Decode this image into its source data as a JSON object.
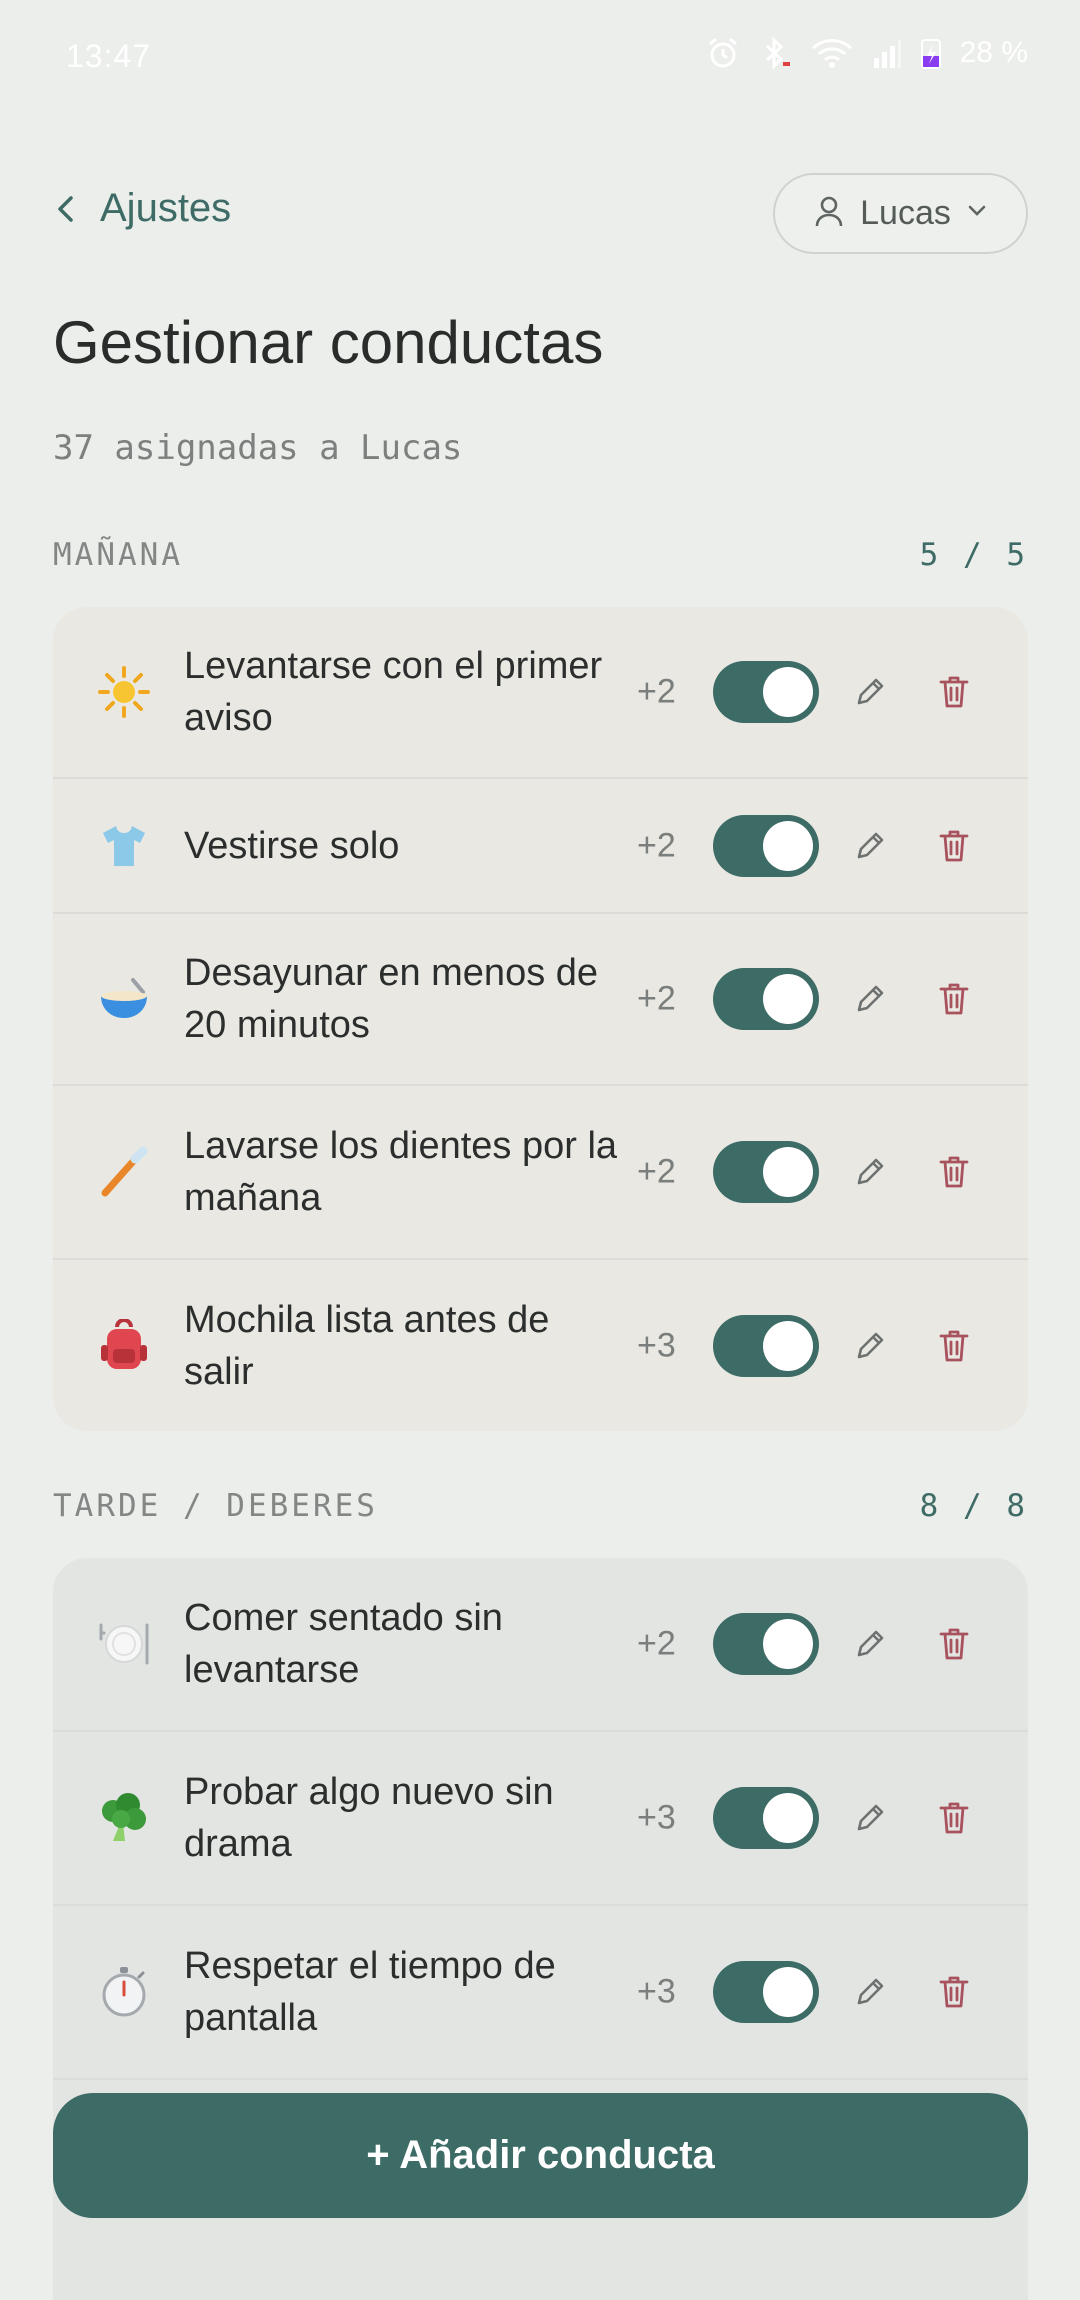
{
  "status_bar": {
    "time": "13:47",
    "battery": "28 %",
    "icons": [
      "alarm-icon",
      "bluetooth-icon",
      "wifi-icon",
      "signal-icon",
      "battery-charging-icon"
    ]
  },
  "header": {
    "back_label": "Ajustes",
    "user_selector": "Lucas",
    "title": "Gestionar conductas",
    "subtitle": "37 asignadas a Lucas"
  },
  "sections": [
    {
      "name": "MAÑANA",
      "count": "5 / 5",
      "items": [
        {
          "icon": "sun-icon",
          "label": "Levantarse con el primer aviso",
          "points": "+2",
          "enabled": true
        },
        {
          "icon": "tshirt-icon",
          "label": "Vestirse solo",
          "points": "+2",
          "enabled": true
        },
        {
          "icon": "bowl-icon",
          "label": "Desayunar en menos de 20 minutos",
          "points": "+2",
          "enabled": true
        },
        {
          "icon": "toothbrush-icon",
          "label": "Lavarse los dientes por la mañana",
          "points": "+2",
          "enabled": true
        },
        {
          "icon": "backpack-icon",
          "label": "Mochila lista antes de salir",
          "points": "+3",
          "enabled": true
        }
      ]
    },
    {
      "name": "TARDE / DEBERES",
      "count": "8 / 8",
      "items": [
        {
          "icon": "plate-icon",
          "label": "Comer sentado sin levantarse",
          "points": "+2",
          "enabled": true
        },
        {
          "icon": "broccoli-icon",
          "label": "Probar algo nuevo sin drama",
          "points": "+3",
          "enabled": true
        },
        {
          "icon": "stopwatch-icon",
          "label": "Respetar el tiempo de pantalla",
          "points": "+3",
          "enabled": true
        }
      ]
    }
  ],
  "add_button": "+ Añadir conducta",
  "colors": {
    "accent": "#3d6b65",
    "background": "#eceeeb",
    "delete": "#a8525e",
    "morning_card": "#e9e8e3",
    "afternoon_card": "#e3e5e3"
  }
}
